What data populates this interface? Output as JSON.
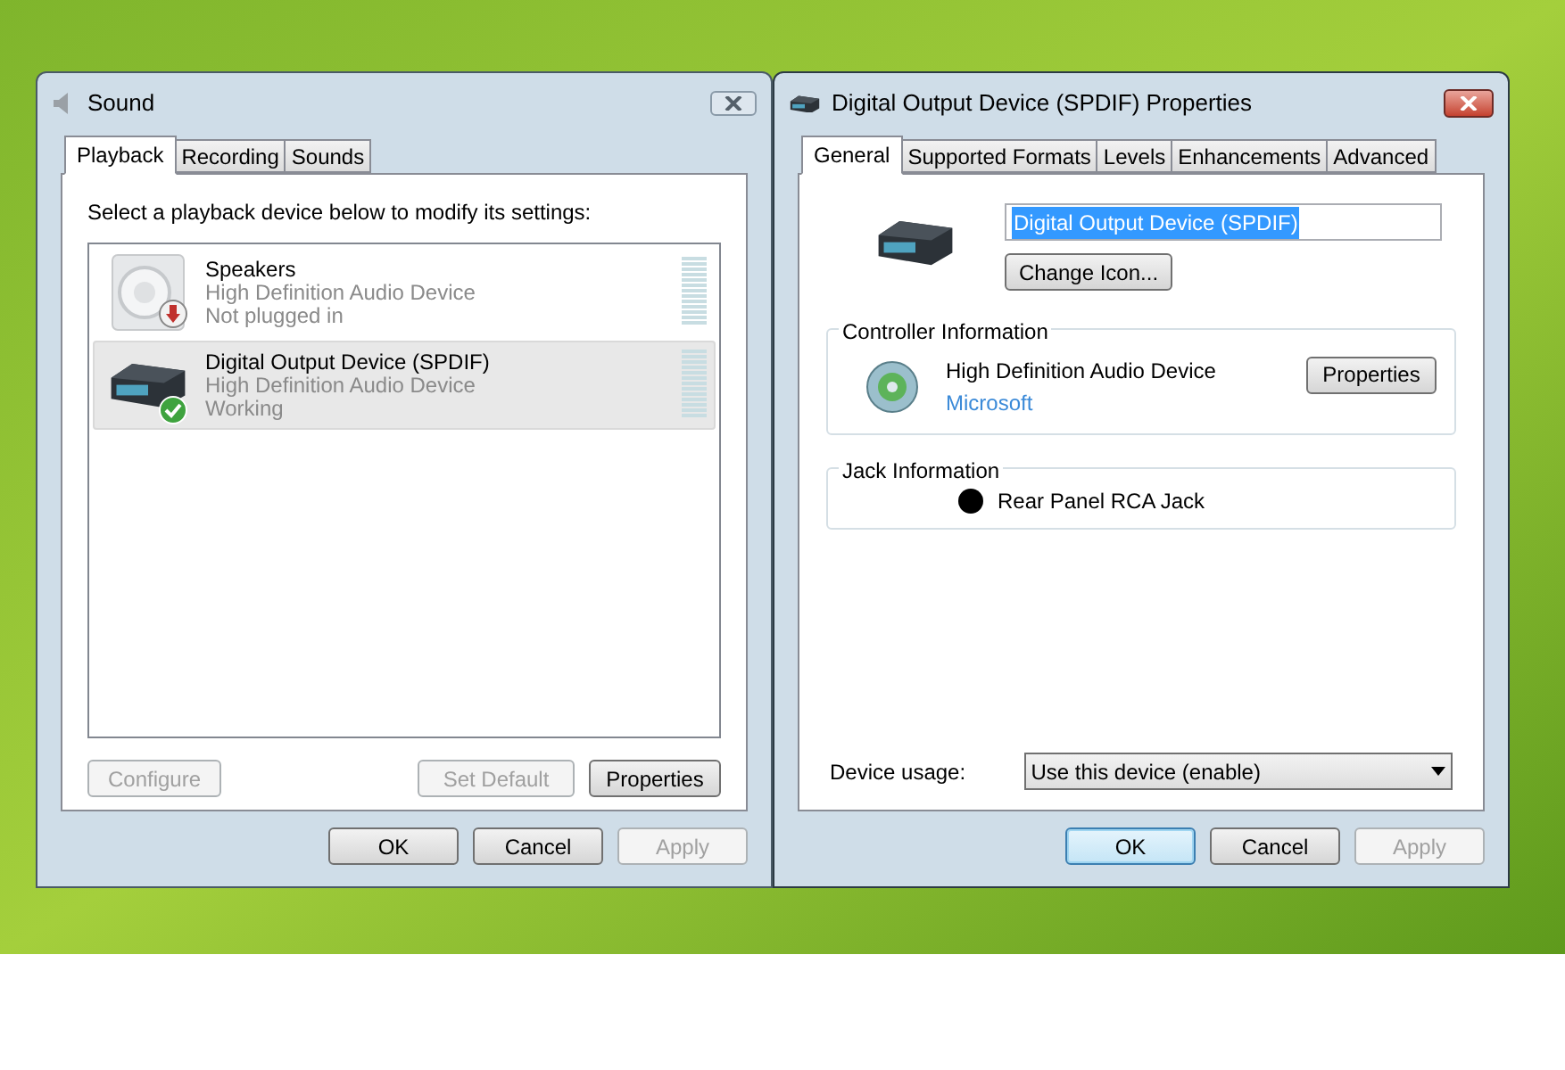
{
  "sound_window": {
    "title": "Sound",
    "tabs": [
      {
        "label": "Playback",
        "selected": true
      },
      {
        "label": "Recording",
        "selected": false
      },
      {
        "label": "Sounds",
        "selected": false
      }
    ],
    "instruction": "Select a playback device below to modify its settings:",
    "devices": [
      {
        "kind": "speakers",
        "name": "Speakers",
        "driver": "High Definition Audio Device",
        "status": "Not plugged in",
        "badge": {
          "kind": "unplugged"
        },
        "selected": false
      },
      {
        "kind": "digital",
        "name": "Digital Output Device (SPDIF)",
        "driver": "High Definition Audio Device",
        "status": "Working",
        "badge": {
          "kind": "working"
        },
        "selected": true
      }
    ],
    "list_buttons": [
      {
        "label": "Configure",
        "disabled": true
      },
      {
        "label": "Set Default",
        "disabled": true
      },
      {
        "label": "Properties",
        "disabled": false
      }
    ],
    "footer_buttons": [
      {
        "label": "OK",
        "disabled": false,
        "default": false
      },
      {
        "label": "Cancel",
        "disabled": false,
        "default": false
      },
      {
        "label": "Apply",
        "disabled": true,
        "default": false
      }
    ]
  },
  "properties_window": {
    "title": "Digital Output Device (SPDIF) Properties",
    "tabs": [
      {
        "label": "General",
        "selected": true
      },
      {
        "label": "Supported Formats",
        "selected": false
      },
      {
        "label": "Levels",
        "selected": false
      },
      {
        "label": "Enhancements",
        "selected": false
      },
      {
        "label": "Advanced",
        "selected": false
      }
    ],
    "device_name": "Digital Output Device (SPDIF)",
    "change_icon_button": "Change Icon...",
    "controller": {
      "heading": "Controller Information",
      "name": "High Definition Audio Device",
      "vendor": "Microsoft",
      "button": "Properties"
    },
    "jack": {
      "heading": "Jack Information",
      "label": "Rear Panel RCA Jack",
      "color": "#000000"
    },
    "device_usage": {
      "label": "Device usage:",
      "value": "Use this device (enable)"
    },
    "footer_buttons": [
      {
        "label": "OK",
        "disabled": false,
        "default": true
      },
      {
        "label": "Cancel",
        "disabled": false,
        "default": false
      },
      {
        "label": "Apply",
        "disabled": true,
        "default": false
      }
    ]
  }
}
